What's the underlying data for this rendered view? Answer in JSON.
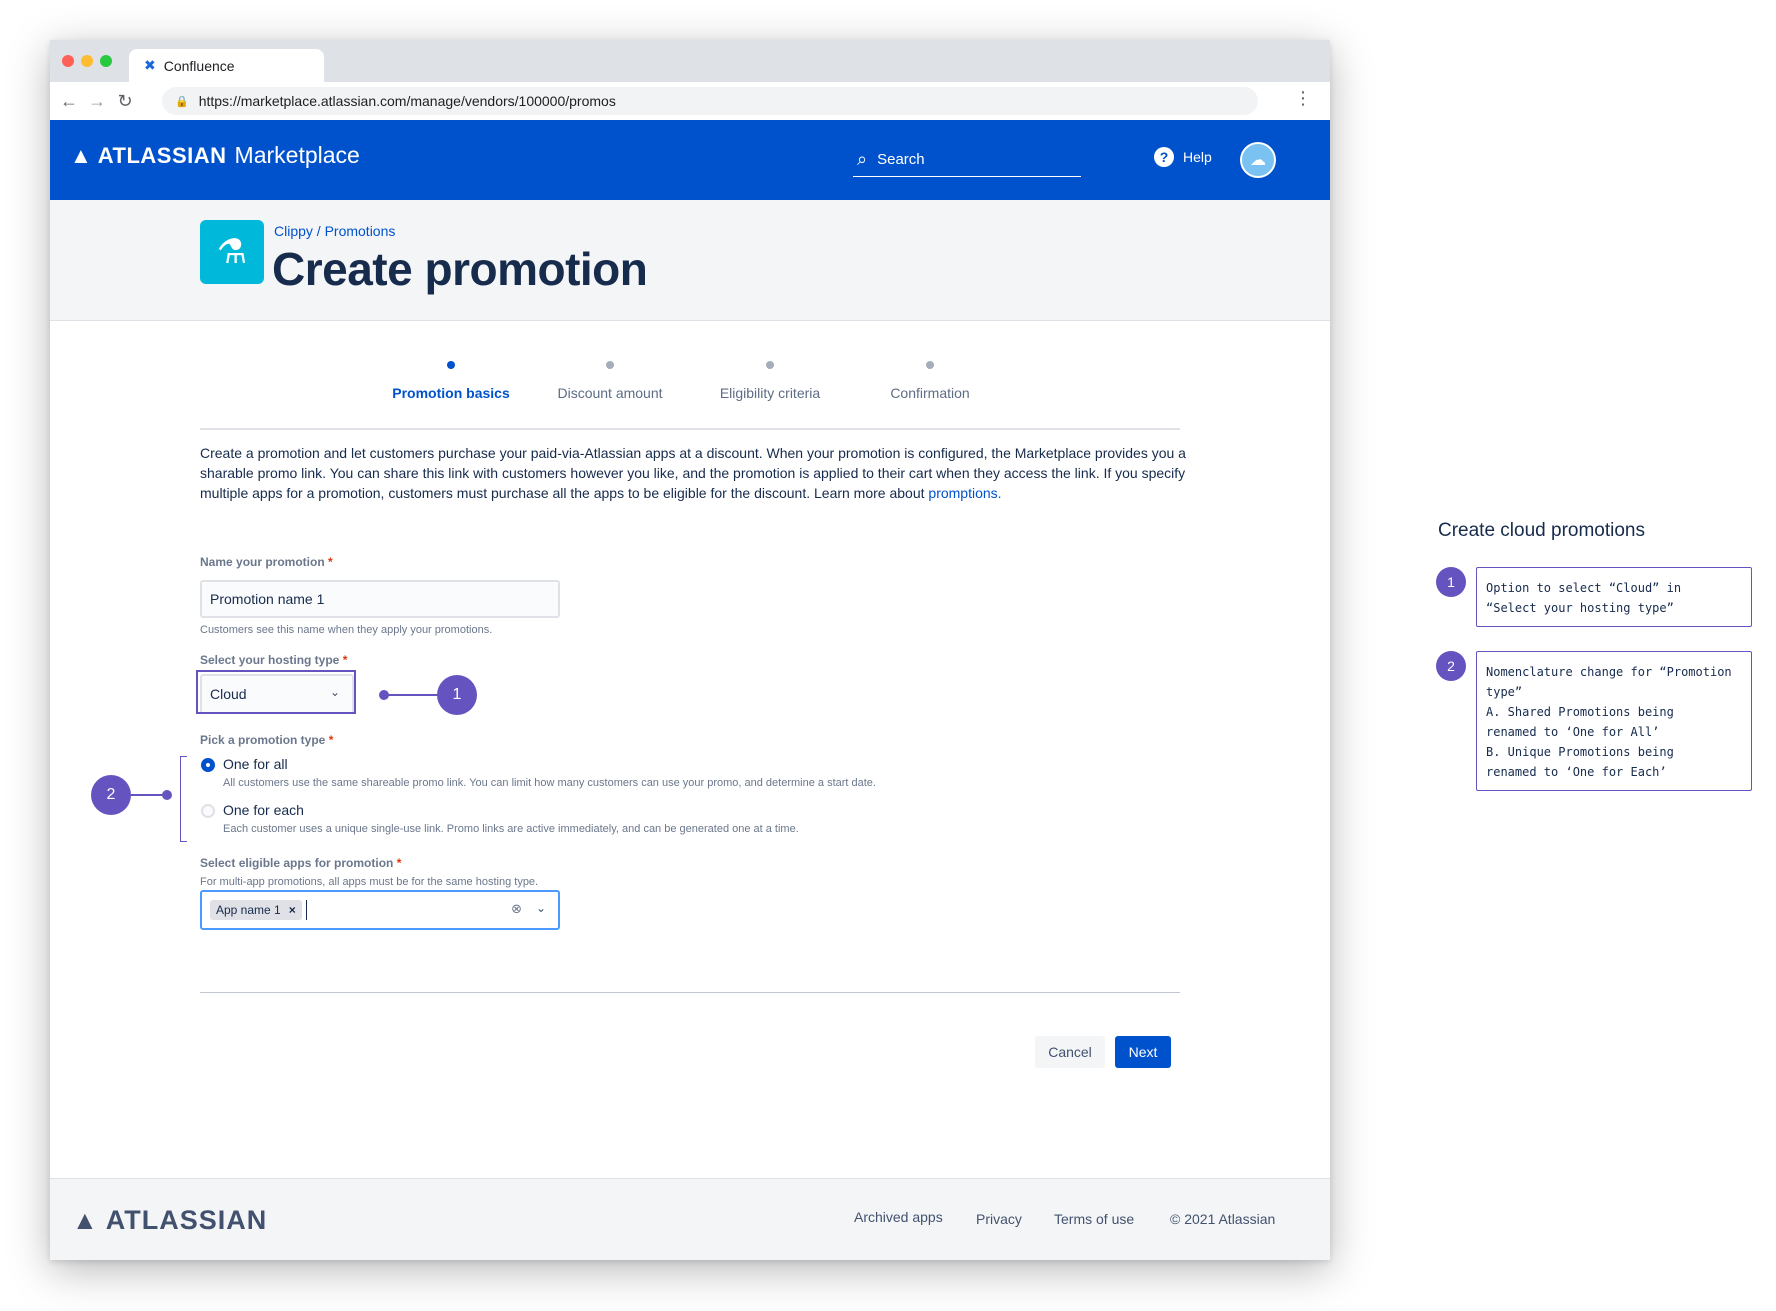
{
  "browser": {
    "tab_title": "Confluence",
    "url": "https://marketplace.atlassian.com/manage/vendors/100000/promos"
  },
  "header": {
    "brand": "ATLASSIAN",
    "product": "Marketplace",
    "search_label": "Search",
    "help_label": "Help"
  },
  "page": {
    "breadcrumb": "Clippy / Promotions",
    "title": "Create promotion"
  },
  "steps": [
    {
      "label": "Promotion basics",
      "active": true
    },
    {
      "label": "Discount amount",
      "active": false
    },
    {
      "label": "Eligibility criteria",
      "active": false
    },
    {
      "label": "Confirmation",
      "active": false
    }
  ],
  "intro": {
    "text": "Create a promotion and let customers purchase your paid-via-Atlassian apps at a discount. When your promotion is configured, the Marketplace provides you a sharable promo link. You can share this link with customers however you like, and the promotion is applied to their cart when they access the link. If you specify multiple apps for a promotion, customers must purchase all the apps to be eligible for the discount. Learn more about ",
    "link": "promptions."
  },
  "form": {
    "name": {
      "label": "Name your promotion",
      "required": "*",
      "value": "Promotion name 1",
      "helper": "Customers see this name when they apply your promotions."
    },
    "hosting": {
      "label": "Select your hosting type",
      "required": "*",
      "value": "Cloud"
    },
    "promo_type": {
      "label": "Pick a promotion type",
      "required": "*",
      "options": [
        {
          "label": "One for all",
          "selected": true,
          "description": "All customers use the same shareable promo link. You can limit how many customers can use your promo, and determine a start date."
        },
        {
          "label": "One for each",
          "selected": false,
          "description": "Each customer uses a unique single-use link. Promo links are active immediately, and can be generated one at a time."
        }
      ]
    },
    "apps": {
      "label": "Select eligible apps for promotion",
      "required": "*",
      "helper": "For multi-app promotions, all apps must be for the same hosting type.",
      "chips": [
        "App name 1"
      ]
    }
  },
  "actions": {
    "cancel": "Cancel",
    "next": "Next"
  },
  "footer": {
    "brand": "ATLASSIAN",
    "links": [
      "Archived apps",
      "Privacy",
      "Terms of use",
      "© 2021 Atlassian"
    ]
  },
  "annotations": {
    "title": "Create cloud promotions",
    "badge1": "1",
    "badge2": "2",
    "note1": "Option to select “Cloud” in\n“Select your hosting type”",
    "note2": "Nomenclature change for “Promotion\ntype”\n A. Shared Promotions being\nrenamed to ‘One for All’\n B. Unique Promotions being\nrenamed to ‘One for Each’"
  },
  "colors": {
    "brand_blue": "#0052cc",
    "annotation_purple": "#6554c0",
    "app_icon": "#00b8d9"
  },
  "icons": [
    "confluence-icon",
    "back-arrow-icon",
    "forward-arrow-icon",
    "reload-icon",
    "lock-icon",
    "kebab-menu-icon",
    "atlassian-logo-icon",
    "search-icon",
    "help-icon",
    "cloud-avatar-icon",
    "flask-icon",
    "chevron-down-icon",
    "clear-icon",
    "remove-chip-icon"
  ]
}
